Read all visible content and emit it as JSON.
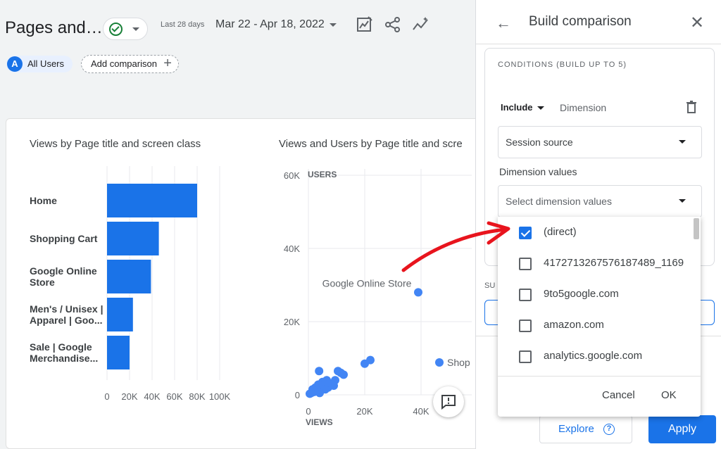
{
  "header": {
    "title": "Pages and…",
    "period_label": "Last 28 days",
    "date_range": "Mar 22 - Apr 18, 2022"
  },
  "segments": {
    "all_users_avatar": "A",
    "all_users": "All Users",
    "add_comparison": "Add comparison"
  },
  "icons": {
    "status": "check-circle-icon",
    "customize": "customize-report-icon",
    "share": "share-icon",
    "insights": "insights-sparkline-icon",
    "feedback": "feedback-icon"
  },
  "colors": {
    "accent": "#1a73e8",
    "bar": "#1a73e8",
    "point": "#4285f4",
    "annotation_arrow": "#e8141d",
    "success": "#188038"
  },
  "chart_data": [
    {
      "type": "bar",
      "title": "Views by Page title and screen class",
      "categories": [
        "Home",
        "Shopping Cart",
        "Google Online Store",
        "Men's / Unisex | Apparel | Goo...",
        "Sale | Google Merchandise..."
      ],
      "category_lines": [
        [
          "Home"
        ],
        [
          "Shopping Cart"
        ],
        [
          "Google Online",
          "Store"
        ],
        [
          "Men's / Unisex |",
          "Apparel | Goo..."
        ],
        [
          "Sale | Google",
          "Merchandise..."
        ]
      ],
      "values": [
        80000,
        46000,
        39000,
        23000,
        20000
      ],
      "xlim": [
        0,
        100000
      ],
      "xticks": [
        "0",
        "20K",
        "40K",
        "60K",
        "80K",
        "100K"
      ],
      "grid": true,
      "orientation": "horizontal"
    },
    {
      "type": "scatter",
      "title": "Views and Users by Page title and scre",
      "xlabel": "VIEWS",
      "ylabel": "USERS",
      "xlim": [
        0,
        40000
      ],
      "ylim": [
        0,
        60000
      ],
      "xticks": [
        "0",
        "20K",
        "40K"
      ],
      "yticks": [
        "0",
        "20K",
        "40K",
        "60K"
      ],
      "grid": true,
      "points": [
        {
          "x": 39000,
          "y": 28000,
          "label": "Google Online Store"
        },
        {
          "x": 22000,
          "y": 9500,
          "label": ""
        },
        {
          "x": 20000,
          "y": 8500,
          "label": ""
        },
        {
          "x": 12500,
          "y": 5500,
          "label": ""
        },
        {
          "x": 11500,
          "y": 6000,
          "label": ""
        },
        {
          "x": 10500,
          "y": 6500,
          "label": ""
        },
        {
          "x": 9500,
          "y": 4000,
          "label": ""
        },
        {
          "x": 9000,
          "y": 2500,
          "label": ""
        },
        {
          "x": 8000,
          "y": 3000,
          "label": ""
        },
        {
          "x": 7000,
          "y": 2000,
          "label": ""
        },
        {
          "x": 6500,
          "y": 4000,
          "label": ""
        },
        {
          "x": 6000,
          "y": 1500,
          "label": ""
        },
        {
          "x": 5500,
          "y": 2500,
          "label": ""
        },
        {
          "x": 5000,
          "y": 3500,
          "label": ""
        },
        {
          "x": 4500,
          "y": 1800,
          "label": ""
        },
        {
          "x": 4000,
          "y": 500,
          "label": ""
        },
        {
          "x": 3800,
          "y": 6500,
          "label": ""
        },
        {
          "x": 3500,
          "y": 2800,
          "label": ""
        },
        {
          "x": 3000,
          "y": 1200,
          "label": ""
        },
        {
          "x": 2500,
          "y": 2000,
          "label": ""
        },
        {
          "x": 2000,
          "y": 800,
          "label": ""
        },
        {
          "x": 1500,
          "y": 1500,
          "label": ""
        },
        {
          "x": 1000,
          "y": 500,
          "label": ""
        },
        {
          "x": 500,
          "y": 300,
          "label": ""
        }
      ],
      "offchart_label": "Shop"
    }
  ],
  "panel": {
    "title": "Build comparison",
    "conditions_heading": "CONDITIONS (BUILD UP TO 5)",
    "include_label": "Include",
    "dimension_label": "Dimension",
    "dimension_select": "Session source",
    "dimension_values_label": "Dimension values",
    "values_placeholder": "Select dimension values",
    "summary_label": "SU",
    "explore": "Explore",
    "explore_help": "?",
    "apply": "Apply"
  },
  "dropdown": {
    "options": [
      {
        "label": "(direct)",
        "checked": true
      },
      {
        "label": "4172713267576187489_1169",
        "checked": false
      },
      {
        "label": "9to5google.com",
        "checked": false
      },
      {
        "label": "amazon.com",
        "checked": false
      },
      {
        "label": "analytics.google.com",
        "checked": false
      }
    ],
    "cancel": "Cancel",
    "ok": "OK"
  }
}
